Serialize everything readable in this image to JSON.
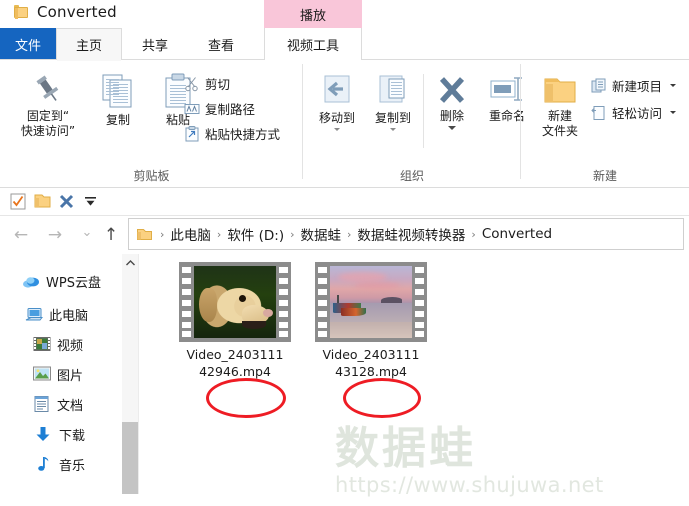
{
  "window": {
    "title": "Converted",
    "folder_icon": "folder-icon"
  },
  "contextual_tab": {
    "label": "播放"
  },
  "tabs": [
    {
      "id": "file",
      "label": "文件"
    },
    {
      "id": "home",
      "label": "主页"
    },
    {
      "id": "share",
      "label": "共享"
    },
    {
      "id": "view",
      "label": "查看"
    },
    {
      "id": "videotools",
      "label": "视频工具"
    }
  ],
  "ribbon": {
    "groups": [
      {
        "id": "clipboard",
        "label": "剪贴板"
      },
      {
        "id": "organize",
        "label": "组织"
      },
      {
        "id": "new",
        "label": "新建"
      }
    ],
    "clipboard": {
      "pin_line1": "固定到“",
      "pin_line2": "快速访问”",
      "copy": "复制",
      "paste": "粘贴",
      "cut": "剪切",
      "copy_path": "复制路径",
      "paste_shortcut": "粘贴快捷方式"
    },
    "organize": {
      "move_to": "移动到",
      "copy_to": "复制到",
      "delete": "删除",
      "rename": "重命名"
    },
    "new": {
      "new_folder_line1": "新建",
      "new_folder_line2": "文件夹",
      "new_item": "新建项目",
      "easy_access": "轻松访问"
    }
  },
  "quick_access": {
    "items": [
      {
        "id": "properties",
        "icon": "properties-check-icon"
      },
      {
        "id": "new-folder",
        "icon": "folder-icon"
      },
      {
        "id": "delete",
        "icon": "delete-x-icon"
      },
      {
        "id": "customize",
        "icon": "chevron-down-icon"
      }
    ]
  },
  "address_bar": {
    "back": "←",
    "forward": "→",
    "recent": "⌄",
    "up": "↑",
    "breadcrumbs": [
      "此电脑",
      "软件 (D:)",
      "数据蛙",
      "数据蛙视频转换器",
      "Converted"
    ],
    "separator": "›"
  },
  "nav_pane": {
    "items": [
      {
        "id": "wps-cloud",
        "label": "WPS云盘",
        "icon": "cloud-icon"
      },
      {
        "id": "this-pc",
        "label": "此电脑",
        "icon": "computer-icon"
      },
      {
        "id": "videos",
        "label": "视频",
        "icon": "video-icon"
      },
      {
        "id": "pictures",
        "label": "图片",
        "icon": "picture-icon"
      },
      {
        "id": "documents",
        "label": "文档",
        "icon": "document-icon"
      },
      {
        "id": "downloads",
        "label": "下载",
        "icon": "download-arrow-icon"
      },
      {
        "id": "music",
        "label": "音乐",
        "icon": "music-note-icon"
      }
    ]
  },
  "files": [
    {
      "id": "file-1",
      "name_line1": "Video_2403111",
      "name_line2": "42946.mp4",
      "full_name": "Video_240311142946.mp4",
      "thumbnail": "dog-thumbnail"
    },
    {
      "id": "file-2",
      "name_line1": "Video_2403111",
      "name_line2": "43128.mp4",
      "full_name": "Video_240311143128.mp4",
      "thumbnail": "beach-sunset-thumbnail"
    }
  ],
  "annotations": {
    "color": "#ee1c24",
    "circles": [
      {
        "id": "circle-file-1",
        "target": "Video_240311142946.mp4"
      },
      {
        "id": "circle-file-2",
        "target": "Video_240311143128.mp4"
      }
    ]
  },
  "watermark": {
    "logo": "数据蛙",
    "url": "https://www.shujuwa.net"
  },
  "colors": {
    "file_tab_blue": "#1565c0",
    "contextual_pink": "#f9c6d9",
    "annotation_red": "#ee1c24",
    "folder_yellow": "#fbd181"
  }
}
